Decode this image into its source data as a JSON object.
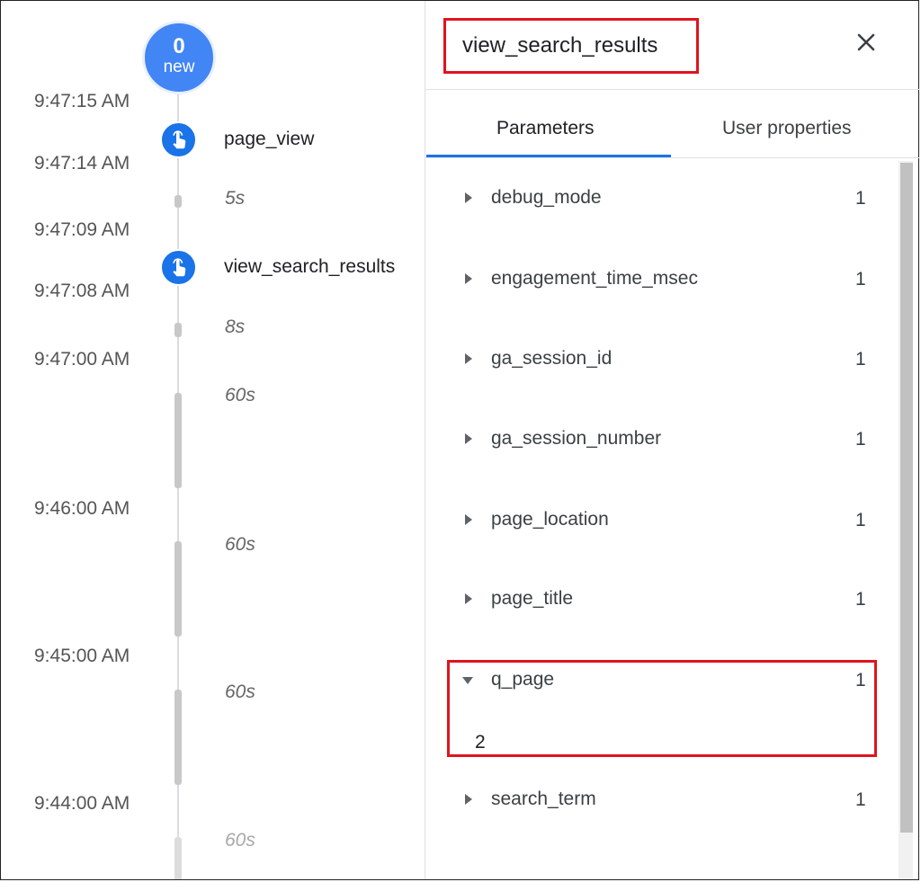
{
  "badge": {
    "count": "0",
    "label": "new"
  },
  "timeline": {
    "times": [
      "9:47:15 AM",
      "9:47:14 AM",
      "9:47:09 AM",
      "9:47:08 AM",
      "9:47:00 AM",
      "9:46:00 AM",
      "9:45:00 AM",
      "9:44:00 AM"
    ],
    "events": [
      "page_view",
      "view_search_results"
    ],
    "durations": [
      "5s",
      "8s",
      "60s",
      "60s",
      "60s",
      "60s"
    ]
  },
  "panel": {
    "title": "view_search_results",
    "tabs": [
      "Parameters",
      "User properties"
    ],
    "params": [
      {
        "name": "debug_mode",
        "count": "1"
      },
      {
        "name": "engagement_time_msec",
        "count": "1"
      },
      {
        "name": "ga_session_id",
        "count": "1"
      },
      {
        "name": "ga_session_number",
        "count": "1"
      },
      {
        "name": "page_location",
        "count": "1"
      },
      {
        "name": "page_title",
        "count": "1"
      },
      {
        "name": "q_page",
        "count": "1",
        "value": "2"
      },
      {
        "name": "search_term",
        "count": "1"
      }
    ]
  },
  "colors": {
    "accent": "#1a73e8",
    "badge": "#4285f4",
    "highlight": "#e0141e"
  }
}
